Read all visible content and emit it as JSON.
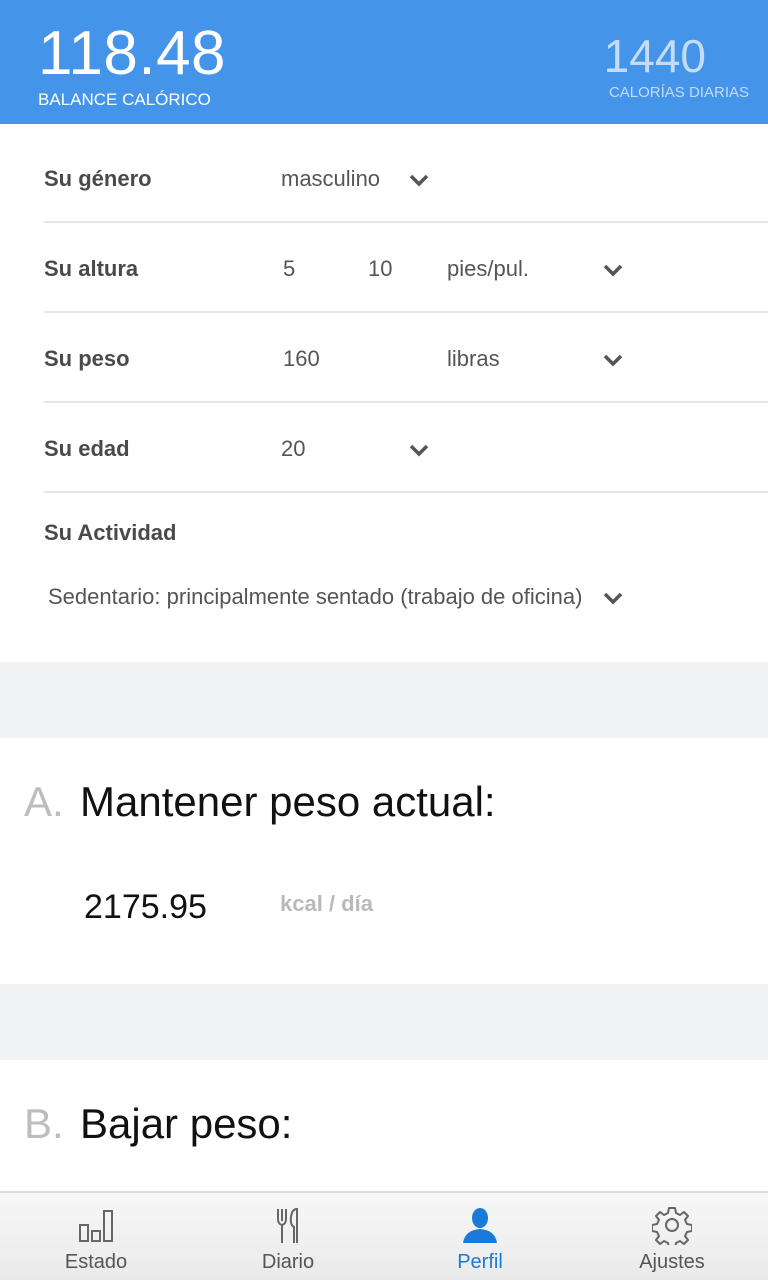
{
  "header": {
    "balance_value": "118.48",
    "balance_label": "BALANCE CALÓRICO",
    "daily_value": "1440",
    "daily_label": "CALORÍAS DIARIAS"
  },
  "profile": {
    "gender": {
      "label": "Su género",
      "value": "masculino"
    },
    "height": {
      "label": "Su altura",
      "feet": "5",
      "inches": "10",
      "unit": "pies/pul."
    },
    "weight": {
      "label": "Su peso",
      "value": "160",
      "unit": "libras"
    },
    "age": {
      "label": "Su edad",
      "value": "20"
    },
    "activity": {
      "label": "Su Actividad",
      "value": "Sedentario: principalmente sentado (trabajo de oficina)"
    }
  },
  "cards": {
    "maintain": {
      "letter": "A.",
      "title": "Mantener peso actual:",
      "value": "2175.95",
      "unit": "kcal / día"
    },
    "lose": {
      "letter": "B.",
      "title": "Bajar peso:"
    }
  },
  "tabs": [
    {
      "label": "Estado",
      "icon": "bar-chart-icon"
    },
    {
      "label": "Diario",
      "icon": "fork-knife-icon"
    },
    {
      "label": "Perfil",
      "icon": "person-icon",
      "active": true
    },
    {
      "label": "Ajustes",
      "icon": "gear-icon"
    }
  ],
  "colors": {
    "header": "#4494ea",
    "active_tab": "#1a7ad8"
  }
}
